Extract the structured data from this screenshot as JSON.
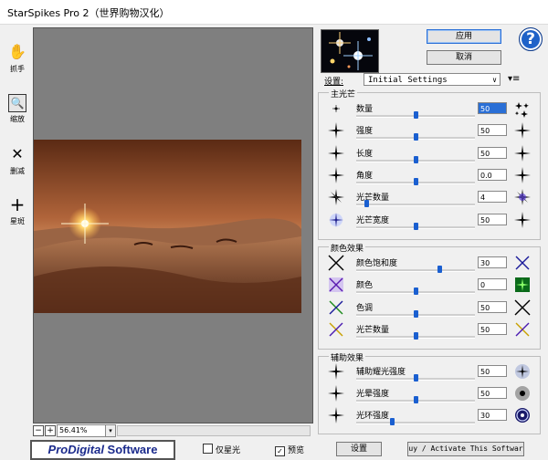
{
  "window": {
    "title": "StarSpikes Pro 2（世界购物汉化）"
  },
  "tools": [
    {
      "name": "hand",
      "label": "抓手"
    },
    {
      "name": "zoom",
      "label": "缩放"
    },
    {
      "name": "delete",
      "label": "删减"
    },
    {
      "name": "add",
      "label": "星斑"
    }
  ],
  "zoom": {
    "minus": "−",
    "plus": "+",
    "value": "56.41%",
    "dropdown": "▾"
  },
  "footer": {
    "logo_a": "Pro",
    "logo_b": "Digital",
    "logo_c": " Software",
    "only_stars": "仅星光",
    "preview": "预览",
    "preview_checked": "✓",
    "settings_btn": "设置",
    "activate_btn": "uy / Activate This Softwar"
  },
  "top": {
    "apply": "应用",
    "cancel": "取消",
    "help": "?"
  },
  "settings": {
    "label": "设置:",
    "value": "Initial Settings",
    "arrow": "∨",
    "menu": "▾≡"
  },
  "groups": {
    "main": {
      "title": "主光芒",
      "rows": [
        {
          "label": "数量",
          "value": "50",
          "pos": 0.5,
          "selected": true
        },
        {
          "label": "强度",
          "value": "50",
          "pos": 0.5
        },
        {
          "label": "长度",
          "value": "50",
          "pos": 0.5
        },
        {
          "label": "角度",
          "value": "0.0",
          "pos": 0.5
        },
        {
          "label": "光芒数量",
          "value": "4",
          "pos": 0.09
        },
        {
          "label": "光芒宽度",
          "value": "50",
          "pos": 0.5
        }
      ]
    },
    "color": {
      "title": "颜色效果",
      "rows": [
        {
          "label": "颜色饱和度",
          "value": "30",
          "pos": 0.7
        },
        {
          "label": "颜色",
          "value": "0",
          "pos": 0.5
        },
        {
          "label": "色调",
          "value": "50",
          "pos": 0.5
        },
        {
          "label": "光芒数量",
          "value": "50",
          "pos": 0.5
        }
      ]
    },
    "aux": {
      "title": "辅助效果",
      "rows": [
        {
          "label": "辅助耀光强度",
          "value": "50",
          "pos": 0.5
        },
        {
          "label": "光晕强度",
          "value": "50",
          "pos": 0.5
        },
        {
          "label": "光环强度",
          "value": "30",
          "pos": 0.3
        }
      ]
    }
  }
}
